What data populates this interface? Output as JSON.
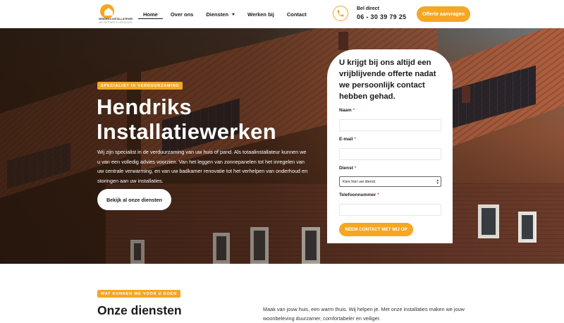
{
  "header": {
    "logo": {
      "name": "logo",
      "line1": "HENDRIKS INSTALLATIEWERKEN BV",
      "line2": "UW PARTNER IN VERDUURZAMING"
    },
    "nav": [
      {
        "label": "Home",
        "active": true
      },
      {
        "label": "Over ons"
      },
      {
        "label": "Diensten",
        "dropdown": true
      },
      {
        "label": "Werken bij"
      },
      {
        "label": "Contact"
      }
    ],
    "phone": {
      "icon": "phone-icon",
      "label": "Bel direct",
      "number": "06 - 30 39 79 25"
    },
    "cta_label": "Offerte aanvragen"
  },
  "hero": {
    "badge": "SPECIALIST IN VERDUURZAMING",
    "title": "Hendriks Installatiewerken",
    "text": "Wij zijn specialist in de verduurzaming van uw huis of pand. Als totaalinstallateur kunnen we u van een volledig advies voorzien. Van het leggen van zonnepanelen tot het inregelen van uw centrale verwarming, en van uw badkamer renovatie tot het verhelpen van onderhoud en storingen aan uw installaties.",
    "button_label": "Bekijk al onze diensten"
  },
  "form": {
    "title": "U krijgt bij ons altijd een vrijblijvende offerte nadat we persoonlijk contact hebben gehad.",
    "fields": [
      {
        "label": "Naam",
        "required": true,
        "type": "text",
        "value": ""
      },
      {
        "label": "E-mail",
        "required": true,
        "type": "email",
        "value": ""
      },
      {
        "label": "Dienst",
        "required": true,
        "type": "select",
        "value": "Kies hier uw dienst"
      },
      {
        "label": "Telefoonnummer",
        "required": true,
        "type": "tel",
        "value": ""
      }
    ],
    "submit_label": "NEEM CONTACT MET MIJ OP"
  },
  "services": {
    "badge": "WAT KUNNEN WE VOOR U DOEN",
    "title": "Onze diensten",
    "text": "Maak van jouw huis, een warm thuis. Wij helpen je. Met onze installaties maken we jouw woonbeleving duurzamer, comfortabeler en veiliger."
  },
  "colors": {
    "accent": "#f5a623",
    "text_dark": "#1a1a1a",
    "required_star": "#e5484d"
  }
}
